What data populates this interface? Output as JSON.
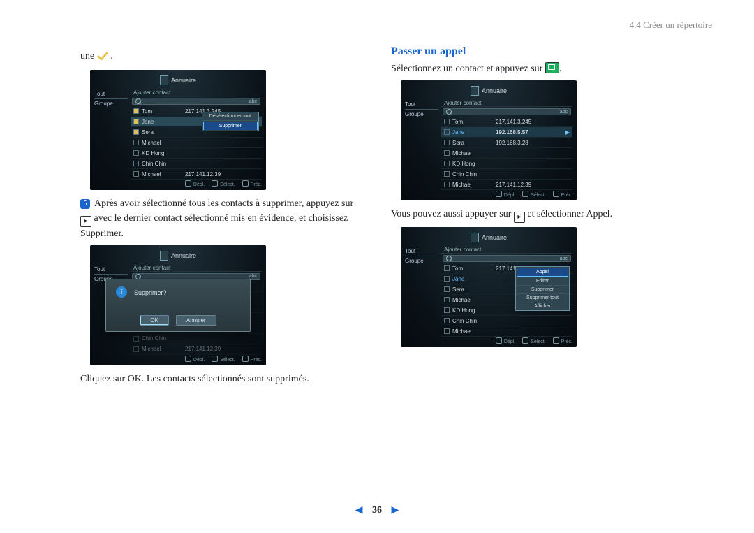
{
  "header": {
    "section": "4.4 Créer un répertoire"
  },
  "left": {
    "une": "une",
    "step5_badge": "5",
    "step5_text": "Après avoir sélectionné tous les contacts à supprimer, appuyez sur ",
    "step5_text2": " avec le dernier contact sélectionné mis en évidence, et choisissez Supprimer.",
    "final_text": "Cliquez sur OK. Les contacts sélectionnés sont supprimés."
  },
  "right": {
    "h2": "Passer un appel",
    "p1a": "Sélectionnez un contact et appuyez sur ",
    "p1b": ".",
    "p2a": "Vous pouvez aussi appuyer sur ",
    "p2b": " et sélectionner Appel."
  },
  "ui": {
    "title": "Annuaire",
    "side_tout": "Tout",
    "side_groupe": "Groupe",
    "add_contact": "Ajouter contact",
    "abc": "abc",
    "rows": [
      {
        "name": "Tom",
        "ip": "217.141.3.245"
      },
      {
        "name": "Jane",
        "ip": ""
      },
      {
        "name": "Sera",
        "ip": ""
      },
      {
        "name": "Michael",
        "ip": ""
      },
      {
        "name": "KD Hong",
        "ip": ""
      },
      {
        "name": "Chin Chin",
        "ip": ""
      },
      {
        "name": "Michael",
        "ip": "217.141.12.39"
      }
    ],
    "rows_ip": [
      {
        "name": "Tom",
        "ip": "217.141.3.245"
      },
      {
        "name": "Jane",
        "ip": "192.168.5.57"
      },
      {
        "name": "Sera",
        "ip": "192.168.3.28"
      },
      {
        "name": "Michael",
        "ip": ""
      },
      {
        "name": "KD Hong",
        "ip": ""
      },
      {
        "name": "Chin Chin",
        "ip": ""
      },
      {
        "name": "Michael",
        "ip": "217.141.12.39"
      }
    ],
    "ctx1": {
      "deselect": "Désélectionner tout",
      "suppr": "Supprimer"
    },
    "ctx2": {
      "appel": "Appel",
      "editer": "Editer",
      "suppr": "Supprimer",
      "suppr_tout": "Supprimer tout",
      "afficher": "Afficher"
    },
    "dlg": {
      "msg": "Supprimer?",
      "ok": "OK",
      "cancel": "Annuler"
    },
    "ftr": {
      "depl": "Dépl.",
      "select": "Sélect.",
      "prec": "Préc."
    }
  },
  "pager": {
    "page": "36"
  }
}
